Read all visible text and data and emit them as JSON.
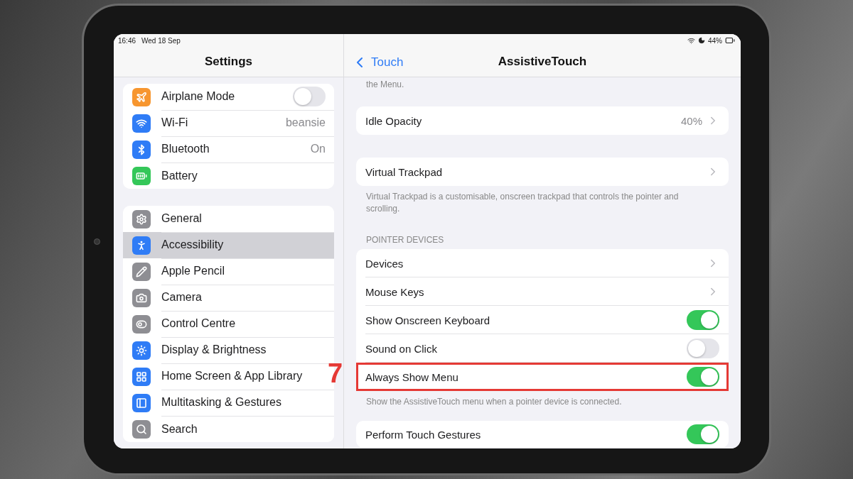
{
  "status_bar": {
    "time": "16:46",
    "date": "Wed 18 Sep",
    "battery": "44%"
  },
  "sidebar": {
    "title": "Settings",
    "groups": [
      [
        {
          "label": "Airplane Mode",
          "kind": "toggle",
          "on": false,
          "color": "#f7962f",
          "selected": false
        },
        {
          "label": "Wi-Fi",
          "kind": "value",
          "value": "beansie",
          "color": "#2f7cf6",
          "selected": false
        },
        {
          "label": "Bluetooth",
          "kind": "value",
          "value": "On",
          "color": "#2f7cf6",
          "selected": false
        },
        {
          "label": "Battery",
          "kind": "link",
          "color": "#34c759",
          "selected": false
        }
      ],
      [
        {
          "label": "General",
          "kind": "link",
          "color": "#8e8e93",
          "selected": false
        },
        {
          "label": "Accessibility",
          "kind": "link",
          "color": "#2f7cf6",
          "selected": true
        },
        {
          "label": "Apple Pencil",
          "kind": "link",
          "color": "#8e8e93",
          "selected": false
        },
        {
          "label": "Camera",
          "kind": "link",
          "color": "#8e8e93",
          "selected": false
        },
        {
          "label": "Control Centre",
          "kind": "link",
          "color": "#8e8e93",
          "selected": false
        },
        {
          "label": "Display & Brightness",
          "kind": "link",
          "color": "#2f7cf6",
          "selected": false
        },
        {
          "label": "Home Screen & App Library",
          "kind": "link",
          "color": "#2f7cf6",
          "selected": false
        },
        {
          "label": "Multitasking & Gestures",
          "kind": "link",
          "color": "#2f7cf6",
          "selected": false
        },
        {
          "label": "Search",
          "kind": "link",
          "color": "#8e8e93",
          "selected": false
        }
      ]
    ]
  },
  "nav": {
    "back": "Touch",
    "title": "AssistiveTouch"
  },
  "content": {
    "top_note": "the Menu.",
    "sections": [
      {
        "rows": [
          {
            "label": "Idle Opacity",
            "kind": "link",
            "value": "40%",
            "highlighted": false
          }
        ]
      },
      {
        "rows": [
          {
            "label": "Virtual Trackpad",
            "kind": "link",
            "highlighted": false
          }
        ],
        "footer": "Virtual Trackpad is a customisable, onscreen trackpad that controls the pointer and scrolling."
      },
      {
        "header": "POINTER DEVICES",
        "rows": [
          {
            "label": "Devices",
            "kind": "link",
            "highlighted": false
          },
          {
            "label": "Mouse Keys",
            "kind": "link",
            "highlighted": false
          },
          {
            "label": "Show Onscreen Keyboard",
            "kind": "toggle",
            "on": true,
            "highlighted": false
          },
          {
            "label": "Sound on Click",
            "kind": "toggle",
            "on": false,
            "highlighted": false
          },
          {
            "label": "Always Show Menu",
            "kind": "toggle",
            "on": true,
            "highlighted": true,
            "callout": "7"
          }
        ],
        "footer": "Show the AssistiveTouch menu when a pointer device is connected."
      },
      {
        "rows": [
          {
            "label": "Perform Touch Gestures",
            "kind": "toggle",
            "on": true,
            "highlighted": false
          }
        ]
      }
    ]
  }
}
